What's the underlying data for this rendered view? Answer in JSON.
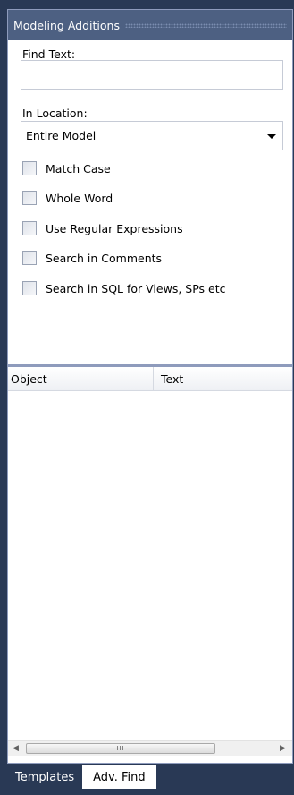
{
  "panel": {
    "title": "Modeling Additions"
  },
  "form": {
    "find_text_label": "Find Text:",
    "find_text_value": "",
    "find_text_placeholder": "",
    "location_label": "In Location:",
    "location_value": "Entire Model",
    "checkboxes": [
      {
        "label": "Match Case",
        "checked": false
      },
      {
        "label": "Whole Word",
        "checked": false
      },
      {
        "label": "Use Regular Expressions",
        "checked": false
      },
      {
        "label": "Search in Comments",
        "checked": false
      },
      {
        "label": "Search in SQL for Views, SPs etc",
        "checked": false
      }
    ]
  },
  "results": {
    "columns": [
      "Object",
      "Text"
    ],
    "rows": [],
    "scrollbar_grip": "III"
  },
  "tabs": [
    {
      "label": "Templates",
      "active": false
    },
    {
      "label": "Adv. Find",
      "active": true
    }
  ],
  "icons": {
    "dropdown": "chevron-down-icon",
    "scroll_left": "arrow-left-icon",
    "scroll_right": "arrow-right-icon"
  },
  "colors": {
    "background": "#293955",
    "titlebar": "#4d6082",
    "panel": "#ffffff"
  }
}
